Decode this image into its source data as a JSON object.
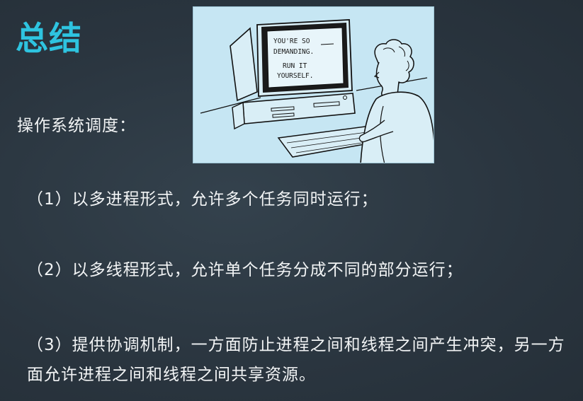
{
  "slide": {
    "title": "总结",
    "subtitle": "操作系统调度：",
    "items": [
      "（1）以多进程形式，允许多个任务同时运行；",
      "（2）以多线程形式，允许单个任务分成不同的部分运行；",
      "（3）提供协调机制，一方面防止进程之间和线程之间产生冲突，另一方面允许进程之间和线程之间共享资源。"
    ],
    "cartoon": {
      "screen_lines": [
        "YOU'RE SO",
        "DEMANDING.",
        "RUN IT",
        "YOURSELF."
      ],
      "colors": {
        "background": "#c6e6f3",
        "ink": "#111111"
      }
    }
  }
}
